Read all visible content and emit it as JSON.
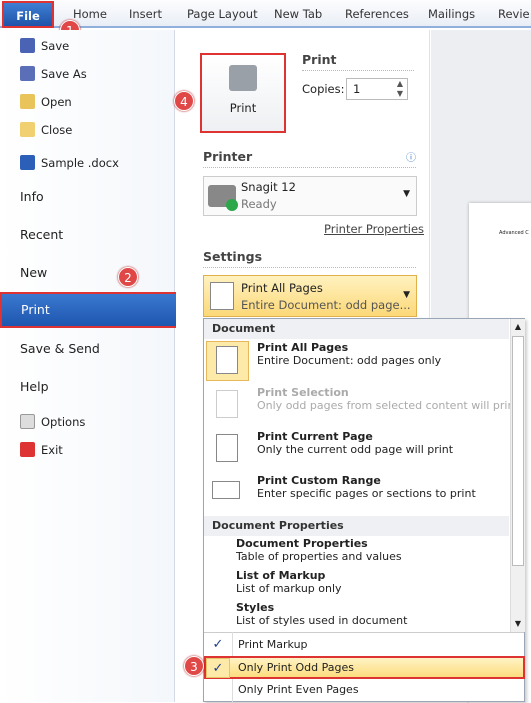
{
  "tabs": {
    "file": "File",
    "items": [
      "Home",
      "Insert",
      "Page Layout",
      "New Tab",
      "References",
      "Mailings",
      "Revie"
    ]
  },
  "nav": {
    "items": [
      {
        "label": "Save",
        "icon": "save-icon"
      },
      {
        "label": "Save As",
        "icon": "save-as-icon"
      },
      {
        "label": "Open",
        "icon": "open-folder-icon"
      },
      {
        "label": "Close",
        "icon": "close-folder-icon"
      },
      {
        "label": "Sample .docx",
        "icon": "word-doc-icon"
      }
    ],
    "big": [
      "Info",
      "Recent",
      "New",
      "Print",
      "Save & Send",
      "Help"
    ],
    "options": "Options",
    "exit": "Exit"
  },
  "badges": [
    "1",
    "2",
    "3",
    "4"
  ],
  "print": {
    "button": "Print",
    "heading": "Print",
    "copies_label": "Copies:",
    "copies_value": "1"
  },
  "printer": {
    "heading": "Printer",
    "name": "Snagit 12",
    "status": "Ready",
    "properties_link": "Printer Properties"
  },
  "settings": {
    "heading": "Settings",
    "selected_title": "Print All Pages",
    "selected_sub": "Entire Document: odd page..."
  },
  "dropdown": {
    "section1": "Document",
    "options": [
      {
        "title": "Print All Pages",
        "sub": "Entire Document: odd pages only"
      },
      {
        "title": "Print Selection",
        "sub": "Only odd pages from selected content will print"
      },
      {
        "title": "Print Current Page",
        "sub": "Only the current odd page will print"
      },
      {
        "title": "Print Custom Range",
        "sub": "Enter specific pages or sections to print"
      }
    ],
    "section2": "Document Properties",
    "props": [
      {
        "title": "Document Properties",
        "sub": "Table of properties and values"
      },
      {
        "title": "List of Markup",
        "sub": "List of markup only"
      },
      {
        "title": "Styles",
        "sub": "List of styles used in document"
      }
    ],
    "toggles": [
      {
        "label": "Print Markup",
        "checked": true
      },
      {
        "label": "Only Print Odd Pages",
        "checked": true
      },
      {
        "label": "Only Print Even Pages",
        "checked": false
      }
    ]
  },
  "preview": {
    "heading": "Advanced C"
  },
  "colors": {
    "accent": "#1e56b0",
    "highlight": "#d33333",
    "selection": "#fde9a8"
  }
}
